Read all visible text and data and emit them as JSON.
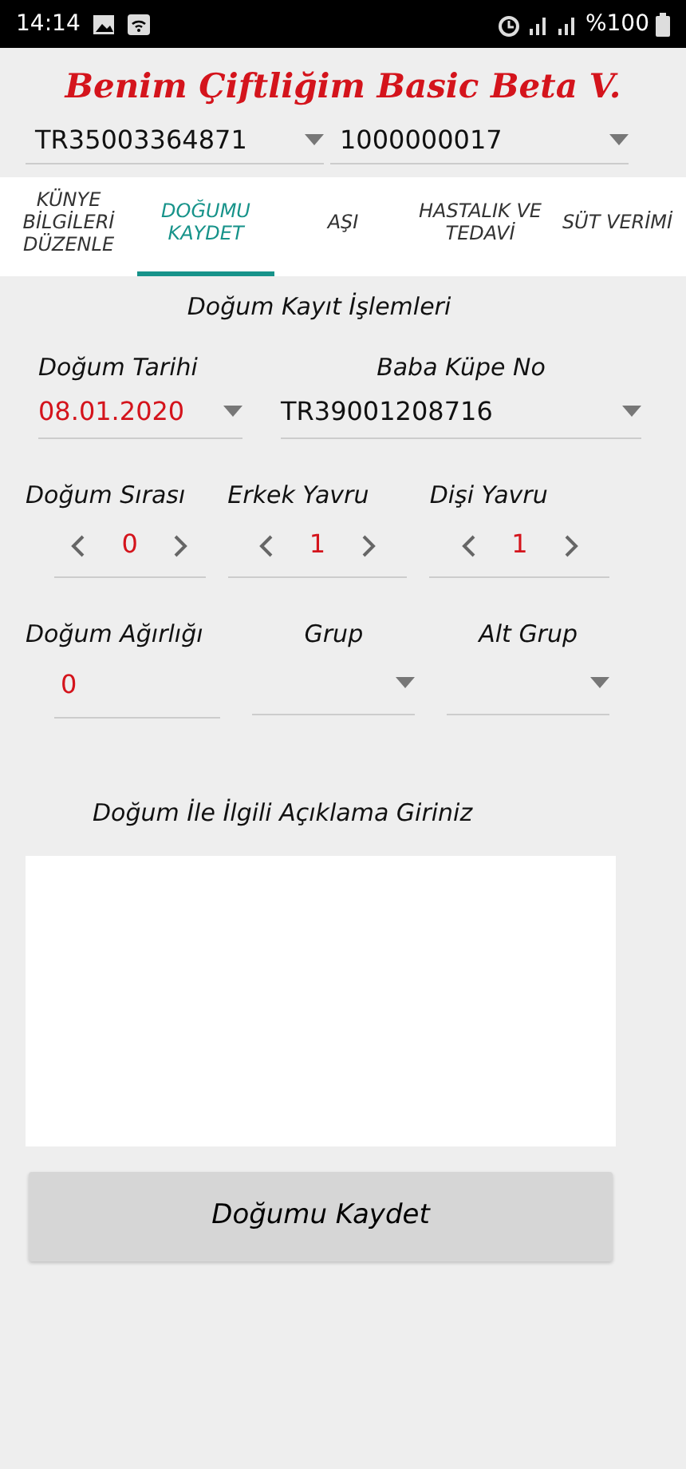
{
  "status_bar": {
    "time": "14:14",
    "battery": "%100"
  },
  "app_title": "Benim Çiftliğim Basic Beta V.",
  "selectors": [
    {
      "value": "TR35003364871"
    },
    {
      "value": "1000000017"
    }
  ],
  "tabs": [
    {
      "label": "KÜNYE BİLGİLERİ DÜZENLE",
      "selected": false
    },
    {
      "label": "DOĞUMU KAYDET",
      "selected": true
    },
    {
      "label": "AŞI",
      "selected": false
    },
    {
      "label": "HASTALIK VE TEDAVİ",
      "selected": false
    },
    {
      "label": "SÜT VERİMİ",
      "selected": false
    }
  ],
  "section_title": "Doğum Kayıt İşlemleri",
  "birth_date": {
    "label": "Doğum Tarihi",
    "value": "08.01.2020"
  },
  "father_tag": {
    "label": "Baba Küpe No",
    "value": "TR39001208716"
  },
  "steppers": [
    {
      "label": "Doğum Sırası",
      "value": "0"
    },
    {
      "label": "Erkek Yavru",
      "value": "1"
    },
    {
      "label": "Dişi Yavru",
      "value": "1"
    }
  ],
  "birth_weight": {
    "label": "Doğum Ağırlığı",
    "value": "0"
  },
  "group": {
    "label": "Grup"
  },
  "subgroup": {
    "label": "Alt Grup"
  },
  "note_label": "Doğum İle İlgili Açıklama Giriniz",
  "save_button": "Doğumu Kaydet"
}
